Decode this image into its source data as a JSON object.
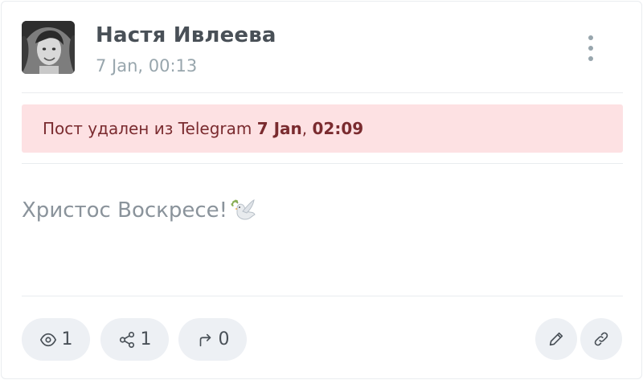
{
  "post": {
    "author": "Настя Ивлеева",
    "timestamp": "7 Jan, 00:13",
    "text": "Христос Воскресе!",
    "emoji": "dove-with-olive-branch"
  },
  "alert": {
    "prefix": "Пост удален из Telegram",
    "deleted_date": "7 Jan",
    "separator": ",",
    "deleted_time": "02:09",
    "color": "#fde1e3"
  },
  "stats": {
    "views": "1",
    "shares": "1",
    "forwards": "0"
  },
  "icons": {
    "menu": "vertical-dots-icon",
    "views": "eye-icon",
    "shares": "share-nodes-icon",
    "forwards": "forward-arrow-icon",
    "edit": "pencil-icon",
    "link": "link-icon"
  }
}
